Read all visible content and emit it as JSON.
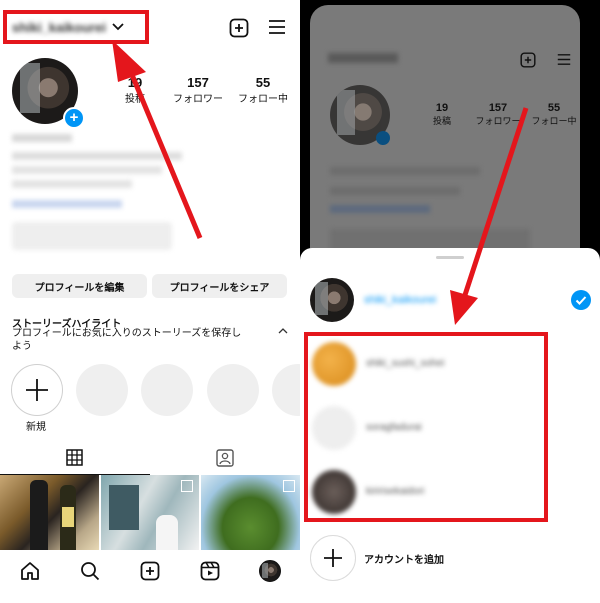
{
  "left": {
    "username": "shiki_kaikourei",
    "stats": [
      {
        "value": "19",
        "label": "投稿"
      },
      {
        "value": "157",
        "label": "フォロワー"
      },
      {
        "value": "55",
        "label": "フォロー中"
      }
    ],
    "buttons": {
      "edit": "プロフィールを編集",
      "share": "プロフィールをシェア"
    },
    "highlights": {
      "title": "ストーリーズハイライト",
      "desc_line1": "プロフィールにお気に入りのストーリーズを保存し",
      "desc_line2": "よう",
      "new_label": "新規"
    }
  },
  "right": {
    "stats": [
      {
        "value": "19",
        "label": "投稿"
      },
      {
        "value": "157",
        "label": "フォロワー"
      },
      {
        "value": "55",
        "label": "フォロー中"
      }
    ],
    "sheet": {
      "current_account": "shiki_kaikourei",
      "accounts": [
        "shiki_sushi_sohei",
        "soragfadurai",
        "kiririsekaidori"
      ],
      "add_account_label": "アカウントを追加"
    }
  },
  "colors": {
    "red": "#e4161c",
    "blue": "#0095f6"
  }
}
